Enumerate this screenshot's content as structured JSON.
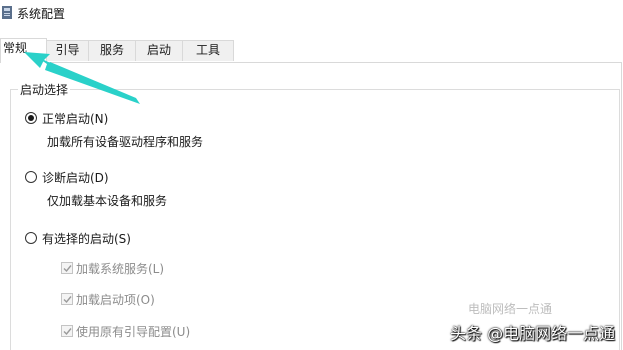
{
  "window": {
    "title": "系统配置",
    "icon": "system-config-icon"
  },
  "tabs": [
    {
      "label": "常规",
      "active": true
    },
    {
      "label": "引导",
      "active": false
    },
    {
      "label": "服务",
      "active": false
    },
    {
      "label": "启动",
      "active": false
    },
    {
      "label": "工具",
      "active": false
    }
  ],
  "startup": {
    "legend": "启动选择",
    "options": [
      {
        "label": "正常启动(N)",
        "description": "加载所有设备驱动程序和服务",
        "checked": true
      },
      {
        "label": "诊断启动(D)",
        "description": "仅加载基本设备和服务",
        "checked": false
      },
      {
        "label": "有选择的启动(S)",
        "checked": false
      }
    ],
    "selective_items": [
      {
        "label": "加载系统服务(L)",
        "checked": true,
        "enabled": false
      },
      {
        "label": "加载启动项(O)",
        "checked": true,
        "enabled": false
      },
      {
        "label": "使用原有引导配置(U)",
        "checked": true,
        "enabled": false
      }
    ]
  },
  "annotation": {
    "arrow_color": "#2ad1c9"
  },
  "watermark": {
    "small": "电脑网络一点通",
    "big": "头条 @电脑网络一点通"
  }
}
